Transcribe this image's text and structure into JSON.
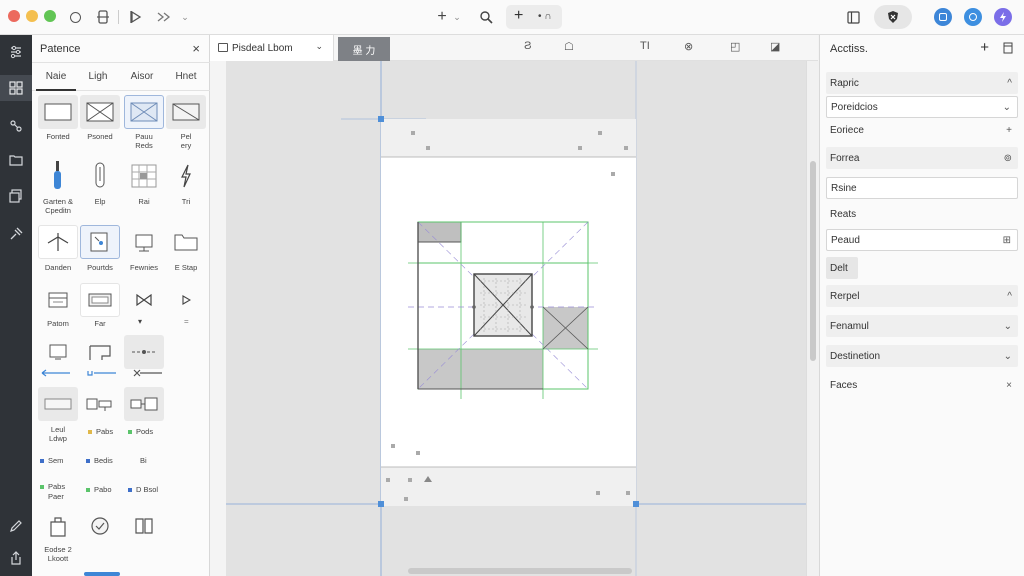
{
  "titlebar": {
    "traffic": [
      "#ec6a5e",
      "#f4bf4f",
      "#61c554"
    ],
    "add_glyph": "+",
    "add_chevron": "⌄",
    "plus2": "+",
    "dots": "• ∩"
  },
  "palette": {
    "title": "Patence",
    "close_glyph": "×",
    "tabs": [
      "Naie",
      "Ligh",
      "Aisor",
      "Hnet"
    ],
    "row1": [
      "Fonted",
      "Psoned",
      "Pauu",
      "Pel"
    ],
    "row1_sub": [
      "",
      "",
      "Reds",
      "ery"
    ],
    "row2": [
      "Garten &",
      "Elp",
      "Rai",
      "Tri"
    ],
    "row2_sub": [
      "Cpeditn",
      "",
      "",
      ""
    ],
    "row3": [
      "Danden",
      "Pourtds",
      "Fewnies",
      "E Stap"
    ],
    "row4": [
      "Patom",
      "Far",
      "",
      ""
    ],
    "row6_left": [
      "Leul",
      "Ldwp"
    ],
    "row6": [
      "Pabs",
      "Pods"
    ],
    "mini1": [
      "Sem",
      "Bedis",
      "Bi"
    ],
    "mini2": [
      "Pabs",
      "Pabo",
      "D Bsol"
    ],
    "mini2_sub": "Paer",
    "last": [
      "Eodse 2",
      "Lkoott"
    ]
  },
  "document": {
    "tab_title": "Pisdeal Lbom",
    "tab_chevron": "⌄",
    "tool_active": "墨 力",
    "tools": [
      "Ϩ",
      "☖",
      "TI",
      "⊗",
      "◰",
      "◪"
    ]
  },
  "right_panel": {
    "title": "Acctiss.",
    "add_glyph": "+",
    "rows": [
      {
        "label": "Rapric",
        "end": "^",
        "style": "shade"
      },
      {
        "label": "Poreidcios",
        "end": "⌄",
        "style": "field"
      },
      {
        "label": "Eoriece",
        "end": "+",
        "style": "plain"
      },
      {
        "label": "Forrea",
        "end": "⊚",
        "style": "shade"
      },
      {
        "label": "Rsine",
        "end": "",
        "style": "field"
      },
      {
        "label": "Reats",
        "end": "",
        "style": "plain"
      },
      {
        "label": "Peaud",
        "end": "⊞",
        "style": "field"
      },
      {
        "label": "Delt",
        "end": "",
        "style": "chip"
      },
      {
        "label": "Rerpel",
        "end": "^",
        "style": "shade"
      },
      {
        "label": "Fenamul",
        "end": "⌄",
        "style": "shade"
      },
      {
        "label": "Destinetion",
        "end": "⌄",
        "style": "shade"
      },
      {
        "label": "Faces",
        "end": "×",
        "style": "plain"
      }
    ]
  },
  "colors": {
    "accent": "#4f8fd8",
    "green_guide": "#5bc46b",
    "purple_guide": "#9a8fd6",
    "rail": "#2f3338"
  }
}
